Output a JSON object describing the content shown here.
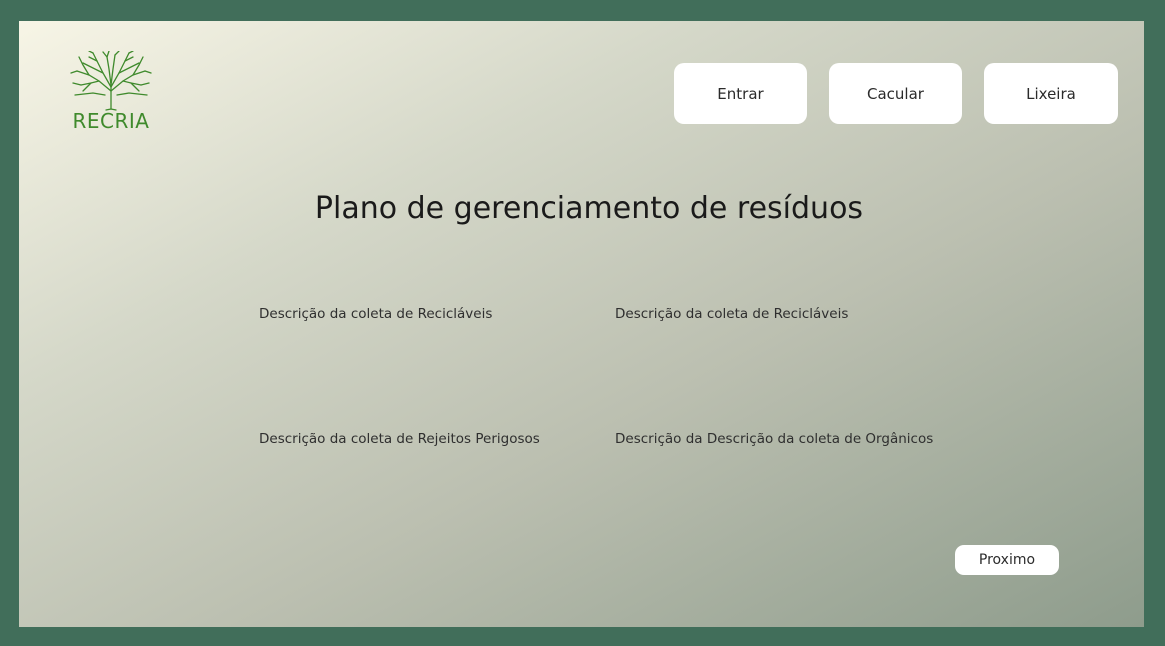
{
  "brand": {
    "logo_text": "RECRIA",
    "logo_icon": "tree-icon",
    "accent_color": "#3f8a2c"
  },
  "nav": {
    "entrar_label": "Entrar",
    "cacular_label": "Cacular",
    "lixeira_label": "Lixeira"
  },
  "main": {
    "title": "Plano de gerenciamento de resíduos",
    "descriptions": [
      "Descrição da coleta de Recicláveis",
      "Descrição da coleta de Recicláveis",
      "Descrição da coleta de Rejeitos Perigosos",
      "Descrição da Descrição da coleta de Orgânicos"
    ]
  },
  "footer": {
    "next_label": "Proximo"
  },
  "colors": {
    "outer_border": "#416e5a",
    "gradient_start": "#f7f5e6",
    "gradient_end": "#8e9c8c"
  }
}
